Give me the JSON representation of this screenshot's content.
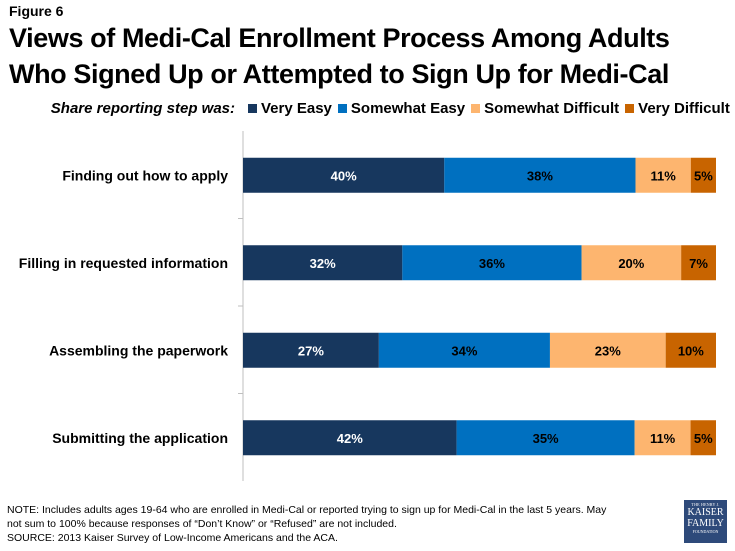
{
  "figure_label": "Figure 6",
  "title": "Views of Medi-Cal Enrollment Process Among Adults Who Signed Up or Attempted to Sign Up for Medi-Cal",
  "chart_data": {
    "type": "bar",
    "orientation": "horizontal",
    "stacked": "100%",
    "title": "Views of Medi-Cal Enrollment Process Among Adults Who Signed Up or Attempted to Sign Up for Medi-Cal",
    "legend_title": "Share reporting step was:",
    "legend_position": "top",
    "categories": [
      "Finding out how to apply",
      "Filling in requested information",
      "Assembling the paperwork",
      "Submitting the application"
    ],
    "series": [
      {
        "name": "Very Easy",
        "color": "#17375e",
        "label_color": "#ffffff",
        "values": [
          40,
          32,
          27,
          42
        ]
      },
      {
        "name": "Somewhat Easy",
        "color": "#0070c0",
        "label_color": "#000000",
        "values": [
          38,
          36,
          34,
          35
        ]
      },
      {
        "name": "Somewhat Difficult",
        "color": "#fdb56f",
        "label_color": "#000000",
        "values": [
          11,
          20,
          23,
          11
        ]
      },
      {
        "name": "Very Difficult",
        "color": "#c86400",
        "label_color": "#000000",
        "values": [
          5,
          7,
          10,
          5
        ]
      }
    ],
    "value_suffix": "%",
    "xlabel": "",
    "ylabel": "",
    "grid": false
  },
  "footer": {
    "note_line1": "NOTE: Includes adults ages 19-64 who are enrolled in Medi-Cal or reported trying to sign up for Medi-Cal in the last 5 years. May",
    "note_line2": "not sum to 100% because responses of “Don’t Know” or “Refused” are not included.",
    "source": "SOURCE: 2013 Kaiser Survey of Low-Income Americans and the ACA."
  },
  "logo": {
    "line1": "THE HENRY J.",
    "line2": "KAISER",
    "line3": "FAMILY",
    "line4": "FOUNDATION"
  }
}
